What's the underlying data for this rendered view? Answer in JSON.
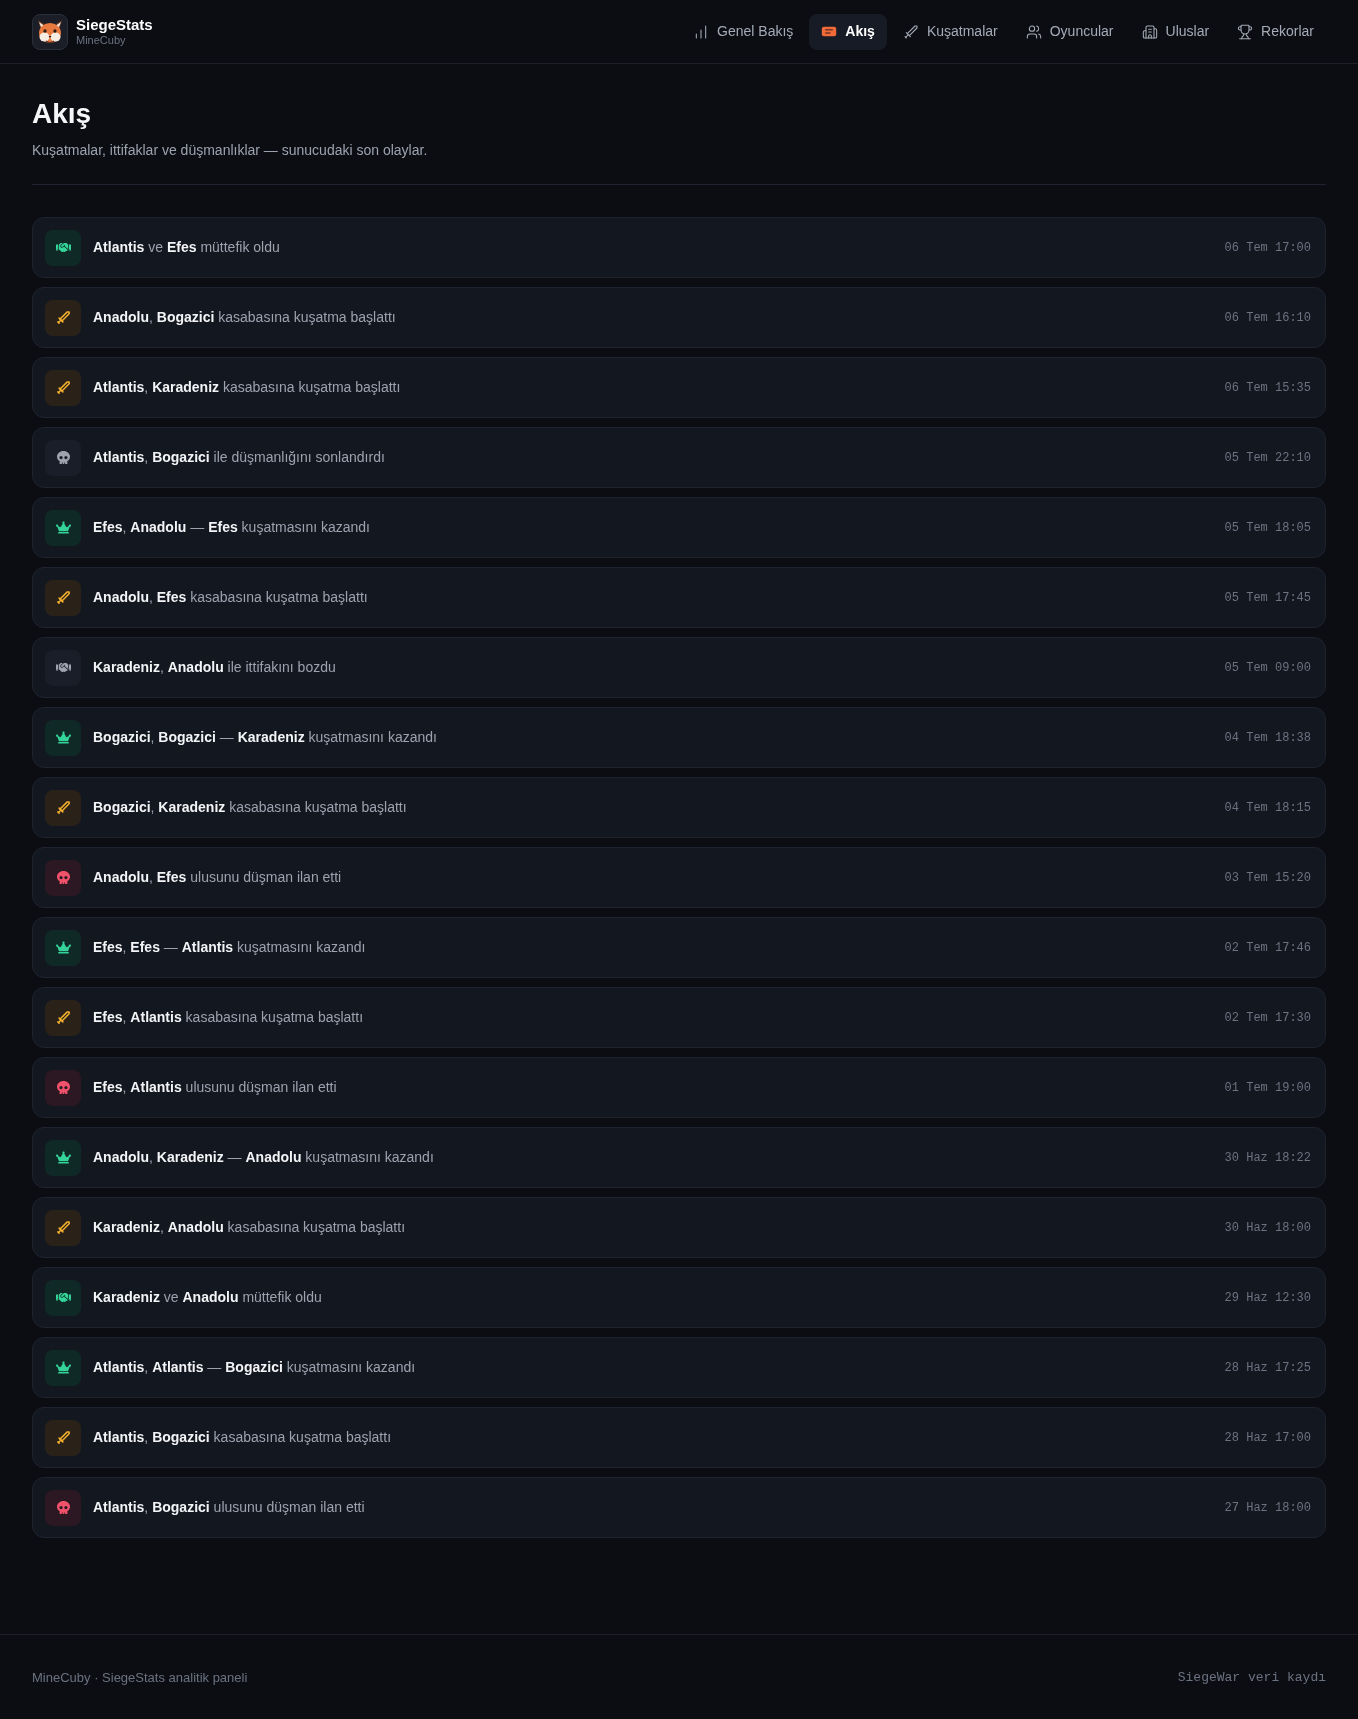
{
  "header": {
    "brand": {
      "title": "SiegeStats",
      "subtitle": "MineCuby"
    },
    "nav": [
      {
        "label": "Genel Bakış",
        "selected": false
      },
      {
        "label": "Akış",
        "selected": true
      },
      {
        "label": "Kuşatmalar",
        "selected": false
      },
      {
        "label": "Oyuncular",
        "selected": false
      },
      {
        "label": "Uluslar",
        "selected": false
      },
      {
        "label": "Rekorlar",
        "selected": false
      }
    ]
  },
  "page": {
    "title": "Akış",
    "subtitle": "Kuşatmalar, ittifaklar ve düşmanlıklar — sunucudaki son olaylar."
  },
  "events": [
    {
      "kind": "alliance",
      "text": "**Atlantis** ve **Efes** müttefik oldu",
      "time": "06 Tem 17:00"
    },
    {
      "kind": "siege_start",
      "text": "**Anadolu**, **Bogazici** kasabasına kuşatma başlattı",
      "time": "06 Tem 16:10"
    },
    {
      "kind": "siege_start",
      "text": "**Atlantis**, **Karadeniz** kasabasına kuşatma başlattı",
      "time": "06 Tem 15:35"
    },
    {
      "kind": "enmity_end",
      "text": "**Atlantis**, **Bogazici** ile düşmanlığını sonlandırdı",
      "time": "05 Tem 22:10"
    },
    {
      "kind": "siege_won",
      "text": "**Efes**, **Anadolu** — **Efes** kuşatmasını kazandı",
      "time": "05 Tem 18:05"
    },
    {
      "kind": "siege_start",
      "text": "**Anadolu**, **Efes** kasabasına kuşatma başlattı",
      "time": "05 Tem 17:45"
    },
    {
      "kind": "alliance_broken",
      "text": "**Karadeniz**, **Anadolu** ile ittifakını bozdu",
      "time": "05 Tem 09:00"
    },
    {
      "kind": "siege_won",
      "text": "**Bogazici**, **Bogazici** — **Karadeniz** kuşatmasını kazandı",
      "time": "04 Tem 18:38"
    },
    {
      "kind": "siege_start",
      "text": "**Bogazici**, **Karadeniz** kasabasına kuşatma başlattı",
      "time": "04 Tem 18:15"
    },
    {
      "kind": "enemy",
      "text": "**Anadolu**, **Efes** ulusunu düşman ilan etti",
      "time": "03 Tem 15:20"
    },
    {
      "kind": "siege_won",
      "text": "**Efes**, **Efes** — **Atlantis** kuşatmasını kazandı",
      "time": "02 Tem 17:46"
    },
    {
      "kind": "siege_start",
      "text": "**Efes**, **Atlantis** kasabasına kuşatma başlattı",
      "time": "02 Tem 17:30"
    },
    {
      "kind": "enemy",
      "text": "**Efes**, **Atlantis** ulusunu düşman ilan etti",
      "time": "01 Tem 19:00"
    },
    {
      "kind": "siege_won",
      "text": "**Anadolu**, **Karadeniz** — **Anadolu** kuşatmasını kazandı",
      "time": "30 Haz 18:22"
    },
    {
      "kind": "siege_start",
      "text": "**Karadeniz**, **Anadolu** kasabasına kuşatma başlattı",
      "time": "30 Haz 18:00"
    },
    {
      "kind": "alliance",
      "text": "**Karadeniz** ve **Anadolu** müttefik oldu",
      "time": "29 Haz 12:30"
    },
    {
      "kind": "siege_won",
      "text": "**Atlantis**, **Atlantis** — **Bogazici** kuşatmasını kazandı",
      "time": "28 Haz 17:25"
    },
    {
      "kind": "siege_start",
      "text": "**Atlantis**, **Bogazici** kasabasına kuşatma başlattı",
      "time": "28 Haz 17:00"
    },
    {
      "kind": "enemy",
      "text": "**Atlantis**, **Bogazici** ulusunu düşman ilan etti",
      "time": "27 Haz 18:00"
    }
  ],
  "footer": {
    "left": "MineCuby · SiegeStats analitik paneli",
    "right": "SiegeWar veri kaydı"
  }
}
